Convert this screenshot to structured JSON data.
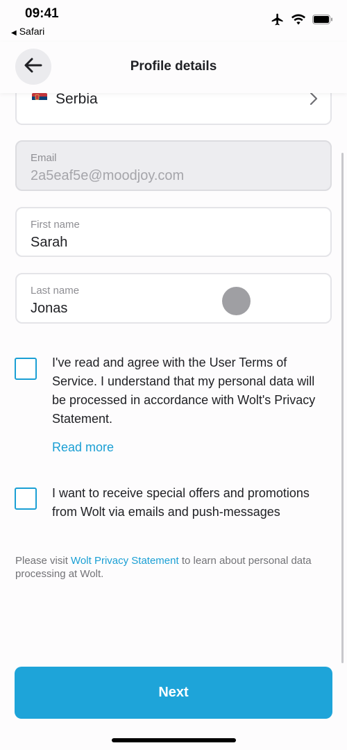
{
  "status_bar": {
    "time": "09:41",
    "back_app": "Safari",
    "icons": [
      "airplane-icon",
      "wifi-icon",
      "battery-icon"
    ]
  },
  "header": {
    "title": "Profile details",
    "back_icon": "arrow-left-icon"
  },
  "form": {
    "country": {
      "value": "Serbia",
      "flag": "serbia-flag-icon",
      "chevron": "chevron-right-icon"
    },
    "email": {
      "label": "Email",
      "value": "2a5eaf5e@moodjoy.com",
      "disabled": true
    },
    "first_name": {
      "label": "First name",
      "value": "Sarah"
    },
    "last_name": {
      "label": "Last name",
      "value": "Jonas"
    }
  },
  "consents": {
    "terms": {
      "checked": false,
      "text": "I've read and agree with the User Terms of Service. I understand that my personal data will be processed in accordance with Wolt's Privacy Statement.",
      "read_more": "Read more"
    },
    "offers": {
      "checked": false,
      "text": "I want to receive special offers and promotions from Wolt via emails and push-messages"
    }
  },
  "privacy_note": {
    "prefix": "Please visit ",
    "link": "Wolt Privacy Statement",
    "suffix": " to learn about personal data processing at Wolt."
  },
  "next_button": {
    "label": "Next"
  },
  "colors": {
    "accent": "#1ea4d9",
    "link": "#1a9fd4",
    "disabled_field_bg": "#ededf0"
  }
}
